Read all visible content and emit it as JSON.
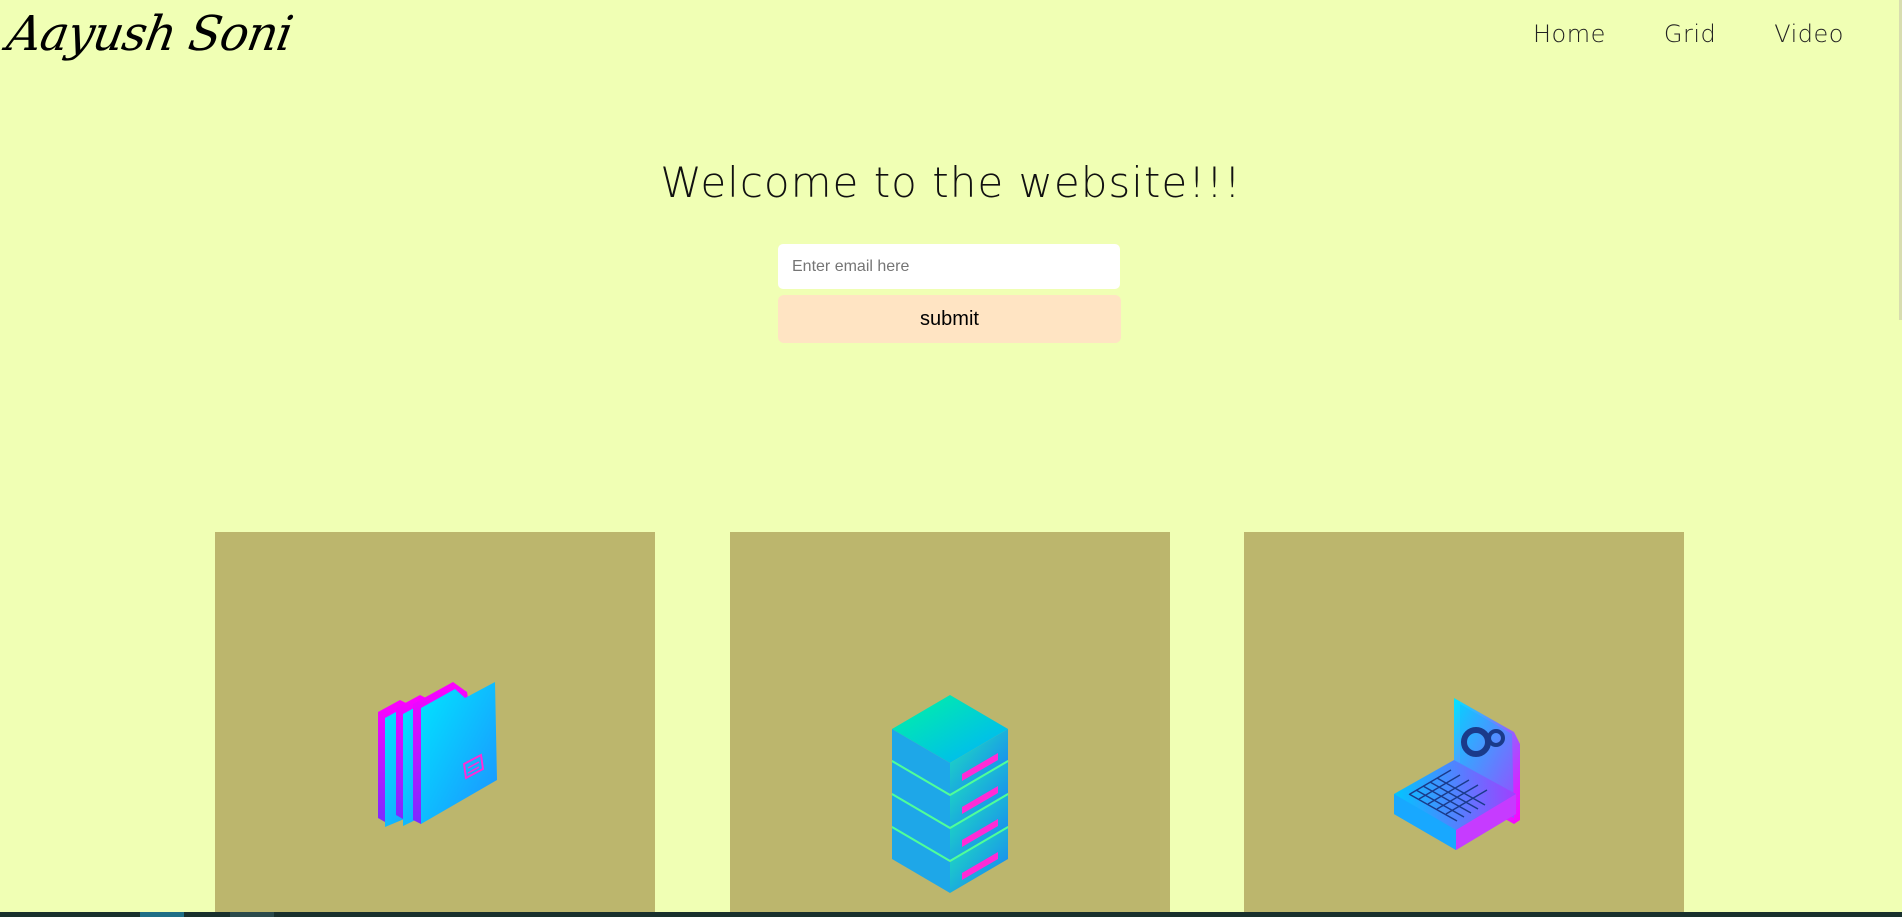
{
  "navbar": {
    "logo_text": "Aayush Soni",
    "links": [
      "Home",
      "Grid",
      "Video"
    ]
  },
  "hero": {
    "title": "Welcome to the website!!!",
    "email_placeholder": "Enter email here",
    "submit_label": "submit"
  },
  "cards": [
    {
      "icon": "folders-icon"
    },
    {
      "icon": "server-stack-icon"
    },
    {
      "icon": "laptop-settings-icon"
    }
  ],
  "colors": {
    "background": "#f0ffb4",
    "card": "#bcb66d",
    "submit_button": "#ffe4c3",
    "input": "#ffffff",
    "icon_gradient_start": "#00e5ff",
    "icon_gradient_end": "#ff00ff"
  }
}
